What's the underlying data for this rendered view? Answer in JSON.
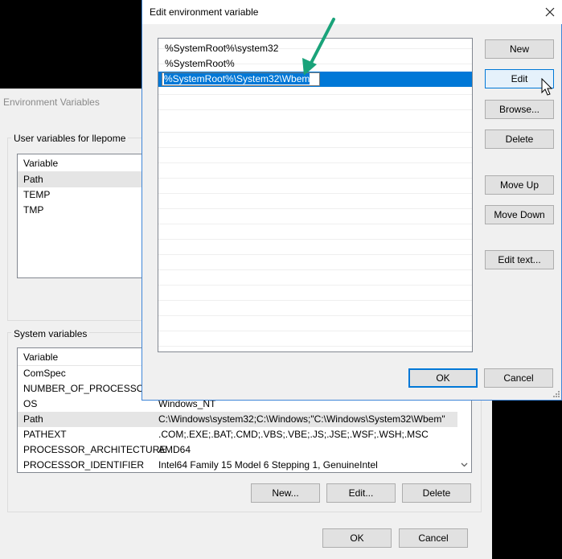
{
  "env_dialog": {
    "title": "Environment Variables",
    "user_group_label": "User variables for llepome",
    "user_table": {
      "header": "Variable",
      "rows": [
        "Path",
        "TEMP",
        "TMP"
      ],
      "selected_index": 0
    },
    "system_group_label": "System variables",
    "system_table": {
      "header": "Variable",
      "rows": [
        {
          "name": "ComSpec",
          "value": ""
        },
        {
          "name": "NUMBER_OF_PROCESSORS",
          "value": ""
        },
        {
          "name": "OS",
          "value": "Windows_NT"
        },
        {
          "name": "Path",
          "value": "C:\\Windows\\system32;C:\\Windows;\"C:\\Windows\\System32\\Wbem\""
        },
        {
          "name": "PATHEXT",
          "value": ".COM;.EXE;.BAT;.CMD;.VBS;.VBE;.JS;.JSE;.WSF;.WSH;.MSC"
        },
        {
          "name": "PROCESSOR_ARCHITECTURE",
          "value": "AMD64"
        },
        {
          "name": "PROCESSOR_IDENTIFIER",
          "value": "Intel64 Family 15 Model 6 Stepping 1, GenuineIntel"
        }
      ],
      "selected_index": 3
    },
    "system_buttons": {
      "new": "New...",
      "edit": "Edit...",
      "delete": "Delete"
    },
    "ok": "OK",
    "cancel": "Cancel"
  },
  "edit_dialog": {
    "title": "Edit environment variable",
    "entries": [
      "%SystemRoot%\\system32",
      "%SystemRoot%"
    ],
    "editing_value": "%SystemRoot%\\System32\\Wbem",
    "buttons": {
      "new": "New",
      "edit": "Edit",
      "browse": "Browse...",
      "delete": "Delete",
      "move_up": "Move Up",
      "move_down": "Move Down",
      "edit_text": "Edit text..."
    },
    "ok": "OK",
    "cancel": "Cancel"
  },
  "colors": {
    "accent": "#0078d7",
    "arrow": "#1aa37a"
  },
  "icons": {
    "close": "close-icon",
    "scroll_down": "chevron-down-icon",
    "annotation": "arrow-icon",
    "pointer": "mouse-pointer-icon"
  }
}
